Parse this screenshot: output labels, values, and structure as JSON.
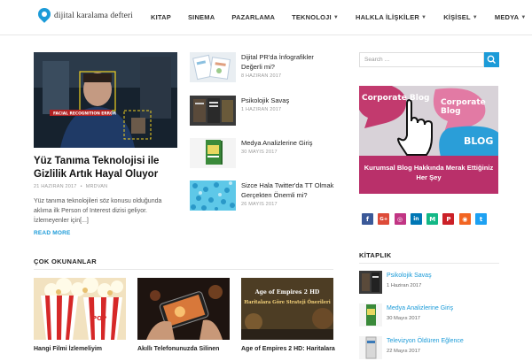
{
  "site": {
    "name": "dijital karalama defteri"
  },
  "nav": [
    {
      "label": "KITAP",
      "dropdown": false
    },
    {
      "label": "SINEMA",
      "dropdown": false
    },
    {
      "label": "PAZARLAMA",
      "dropdown": false
    },
    {
      "label": "TEKNOLOJI",
      "dropdown": true
    },
    {
      "label": "HALKLA İLİŞKİLER",
      "dropdown": true
    },
    {
      "label": "KİŞİSEL",
      "dropdown": true
    },
    {
      "label": "MEDYA",
      "dropdown": true
    }
  ],
  "featured": {
    "image_label": "FACIAL RECOGNITION ERROR",
    "title": "Yüz Tanıma Teknolojisi ile Gizlilik Artık Hayal Oluyor",
    "date": "21 HAZIRAN 2017",
    "author": "MRDVAN",
    "excerpt": "Yüz tanıma teknolojileri söz konusu olduğunda aklıma ilk Person of Interest dizisi geliyor. İzlemeyenler için[...]",
    "read_more": "READ MORE"
  },
  "side_posts": [
    {
      "title": "Dijital PR'da İnfografikler Değerli mi?",
      "date": "8 HAZIRAN 2017"
    },
    {
      "title": "Psikolojik Savaş",
      "date": "1 HAZIRAN 2017"
    },
    {
      "title": "Medya Analizlerine Giriş",
      "date": "30 MAYIS 2017"
    },
    {
      "title": "Sizce Hala Twitter'da TT Olmak Gerçekten Önemli mi?",
      "date": "26 MAYIS 2017"
    }
  ],
  "popular": {
    "heading": "ÇOK OKUNANLAR",
    "posts": [
      {
        "title": "Hangi Filmi İzlemeliyim"
      },
      {
        "title": "Akıllı Telefonunuzda Silinen"
      },
      {
        "title": "Age of Empires 2 HD: Haritalara",
        "image_text": "Age of Empires 2 HD Haritalara Göre Strateji Önerileri"
      }
    ]
  },
  "sidebar": {
    "search_placeholder": "Search …",
    "banner": {
      "bubble1": "Corporate Blog",
      "bubble2": "Corporate Blog",
      "bubble3": "BLOG",
      "caption": "Kurumsal Blog Hakkında Merak Ettiğiniz Her Şey"
    },
    "social": [
      {
        "name": "facebook-icon",
        "glyph": "f",
        "color": "#3b5998"
      },
      {
        "name": "google-plus-icon",
        "glyph": "G+",
        "color": "#dd4b39"
      },
      {
        "name": "instagram-icon",
        "glyph": "◎",
        "color": "#c13584"
      },
      {
        "name": "linkedin-icon",
        "glyph": "in",
        "color": "#0077b5"
      },
      {
        "name": "medium-icon",
        "glyph": "M",
        "color": "#12b886"
      },
      {
        "name": "pinterest-icon",
        "glyph": "P",
        "color": "#cb2027"
      },
      {
        "name": "rss-icon",
        "glyph": "◉",
        "color": "#f26522"
      },
      {
        "name": "twitter-icon",
        "glyph": "t",
        "color": "#1da1f2"
      }
    ],
    "books_heading": "KİTAPLIK",
    "books": [
      {
        "title": "Psikolojik Savaş",
        "date": "1 Haziran 2017"
      },
      {
        "title": "Medya Analizlerine Giriş",
        "date": "30 Mayıs 2017"
      },
      {
        "title": "Televizyon Öldüren Eğlence",
        "date": "22 Mayıs 2017"
      }
    ]
  },
  "colors": {
    "accent": "#1c9bd8",
    "banner": "#c93c70"
  }
}
